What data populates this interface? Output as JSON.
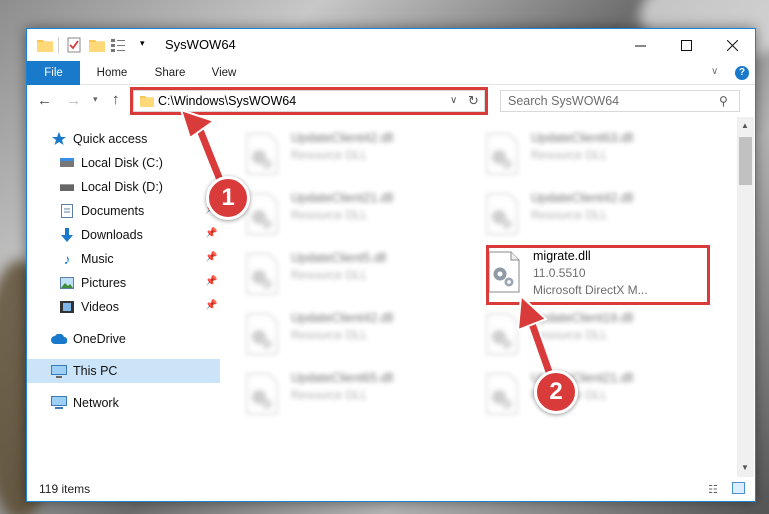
{
  "window": {
    "title": "SysWOW64",
    "minimize_icon": "minimize-icon",
    "maximize_icon": "maximize-icon",
    "close_icon": "close-icon"
  },
  "ribbon": {
    "tabs": [
      {
        "label": "File"
      },
      {
        "label": "Home"
      },
      {
        "label": "Share"
      },
      {
        "label": "View"
      }
    ],
    "help_label": "?"
  },
  "address": {
    "path": "C:\\Windows\\SysWOW64",
    "search_placeholder": "Search SysWOW64"
  },
  "sidebar": {
    "items": [
      {
        "label": "Quick access",
        "icon": "star-icon"
      },
      {
        "label": "Local Disk (C:)",
        "icon": "drive-icon"
      },
      {
        "label": "Local Disk (D:)",
        "icon": "drive-icon"
      },
      {
        "label": "Documents",
        "icon": "documents-icon",
        "pinned": true
      },
      {
        "label": "Downloads",
        "icon": "downloads-icon",
        "pinned": true
      },
      {
        "label": "Music",
        "icon": "music-icon",
        "pinned": true
      },
      {
        "label": "Pictures",
        "icon": "pictures-icon",
        "pinned": true
      },
      {
        "label": "Videos",
        "icon": "videos-icon",
        "pinned": true
      },
      {
        "label": "OneDrive",
        "icon": "cloud-icon"
      },
      {
        "label": "This PC",
        "icon": "computer-icon",
        "selected": true
      },
      {
        "label": "Network",
        "icon": "network-icon"
      }
    ]
  },
  "files": [
    {
      "name": "UpdateClient42.dll",
      "desc": "Resource DLL"
    },
    {
      "name": "UpdateClient63.dll",
      "desc": "Resource DLL"
    },
    {
      "name": "UpdateClient21.dll",
      "desc": "Resource DLL"
    },
    {
      "name": "UpdateClient42.dll",
      "desc": "Resource DLL"
    },
    {
      "name": "UpdateClient5.dll",
      "desc": "Resource DLL"
    },
    {
      "name": "migrate.dll",
      "version": "11.0.5510",
      "desc": "Microsoft DirectX M..."
    },
    {
      "name": "UpdateClient42.dll",
      "desc": "Resource DLL"
    },
    {
      "name": "UpdateClient19.dll",
      "desc": "Resource DLL"
    },
    {
      "name": "UpdateClient65.dll",
      "desc": "Resource DLL"
    },
    {
      "name": "UpdateClient21.dll",
      "desc": "Resource DLL"
    }
  ],
  "status": {
    "item_count": "119 items"
  },
  "annotations": {
    "step1": "1",
    "step2": "2",
    "highlight_color": "#d93a3a"
  },
  "colors": {
    "accent": "#1979ca",
    "selection": "#cce4f7"
  }
}
